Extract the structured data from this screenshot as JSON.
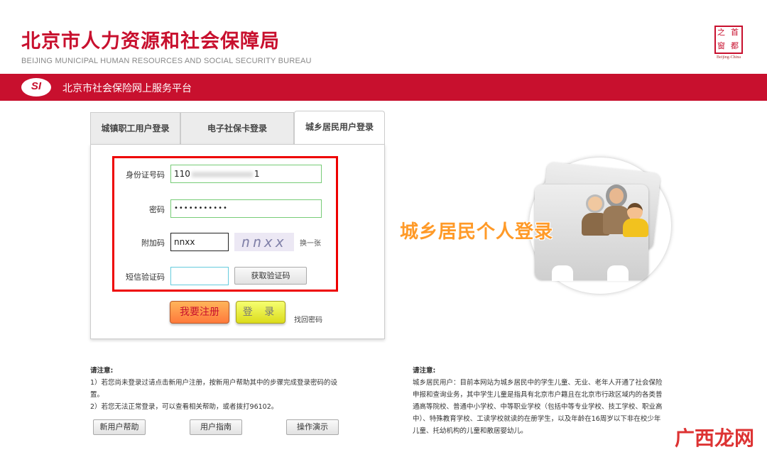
{
  "header": {
    "title": "北京市人力资源和社会保障局",
    "subtitle": "BEIJING MUNICIPAL HUMAN RESOURCES AND SOCIAL SECURITY BUREAU",
    "seal": {
      "chars": [
        "之",
        "首",
        "窗",
        "都"
      ],
      "caption": "Beijing-China"
    }
  },
  "bar": {
    "logo": "SI",
    "platform": "北京市社会保险网上服务平台"
  },
  "tabs": [
    {
      "label": "城镇职工用户登录"
    },
    {
      "label": "电子社保卡登录"
    },
    {
      "label": "城乡居民用户登录",
      "active": true
    }
  ],
  "form": {
    "id_label": "身份证号码",
    "id_value_prefix": "110",
    "id_value_suffix": "1",
    "password_label": "密码",
    "password_value": "•••••••••••",
    "captcha_label": "附加码",
    "captcha_value": "nnxx",
    "captcha_image_text": "nnxx",
    "refresh_label": "换一张",
    "sms_label": "短信验证码",
    "sms_value": "",
    "sms_button": "获取验证码",
    "register_button": "我要注册",
    "login_button": "登 录",
    "forgot_link": "找回密码"
  },
  "illustration": {
    "text": "城乡居民个人登录"
  },
  "notice_left": {
    "heading": "请注意:",
    "lines": [
      "1）若您尚未登录过请点击新用户注册，按新用户帮助其中的步骤完成登录密码的设",
      "置。",
      "2）若您无法正常登录，可以查看相关帮助，或者拨打96102。"
    ],
    "buttons": [
      "新用户帮助",
      "用户指南",
      "操作演示"
    ]
  },
  "notice_right": {
    "heading": "请注意:",
    "lines": [
      "城乡居民用户：目前本网站为城乡居民中的学生儿童、无业、老年人开通了社会保险",
      "申报和查询业务，其中学生儿童是指具有北京市户籍且在北京市行政区域内的各类普",
      "通高等院校、普通中小学校、中等职业学校（包括中等专业学校、技工学校、职业高",
      "中）、特殊教育学校、工读学校就读的在册学生，以及年龄在16周岁以下非在校少年",
      "儿童、托幼机构的儿童和散居婴幼儿。"
    ]
  },
  "watermark": "广西龙网",
  "colors": {
    "brand_red": "#c8102e",
    "highlight_box": "#ee0000",
    "illustration_text": "#ff9a28"
  }
}
